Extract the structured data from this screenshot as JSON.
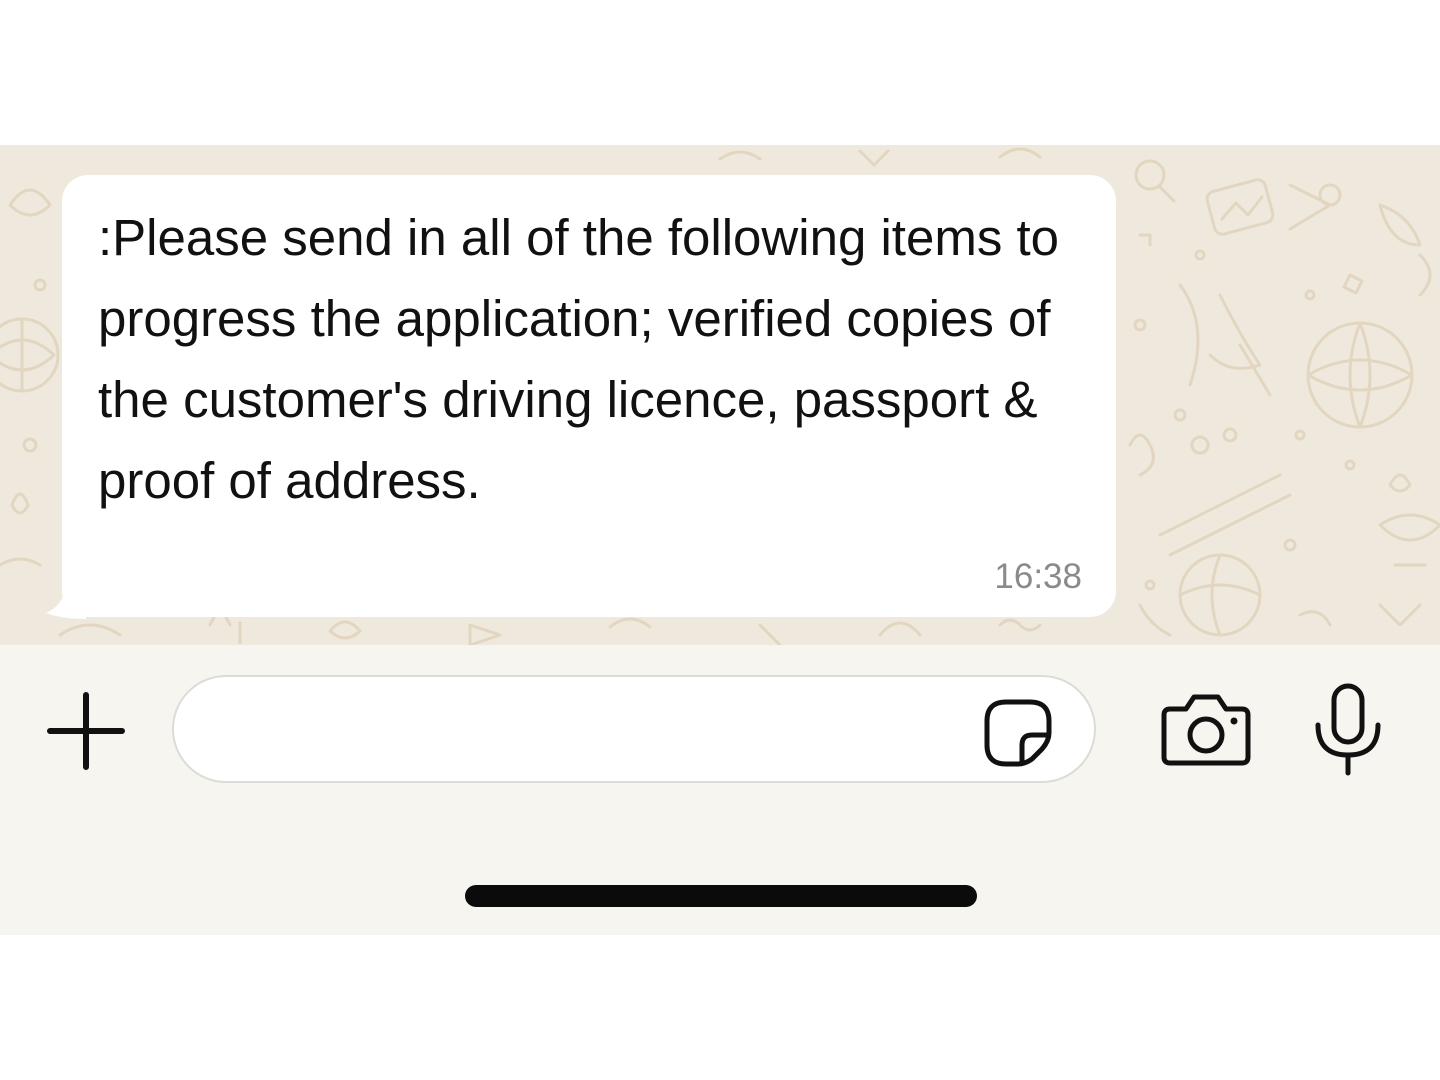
{
  "message": {
    "text": ":Please send in all of the following items to progress the application; verified copies of the customer's driving licence, passport & proof of address.",
    "time": "16:38"
  },
  "composer": {
    "input_value": "",
    "input_placeholder": ""
  },
  "icons": {
    "attach": "plus-icon",
    "sticker": "sticker-icon",
    "camera": "camera-icon",
    "microphone": "microphone-icon"
  },
  "colors": {
    "chat_background": "#efe9dd",
    "bubble": "#ffffff",
    "input_bar": "#f6f5f0",
    "text": "#111111",
    "timestamp": "#8a8a8a"
  }
}
